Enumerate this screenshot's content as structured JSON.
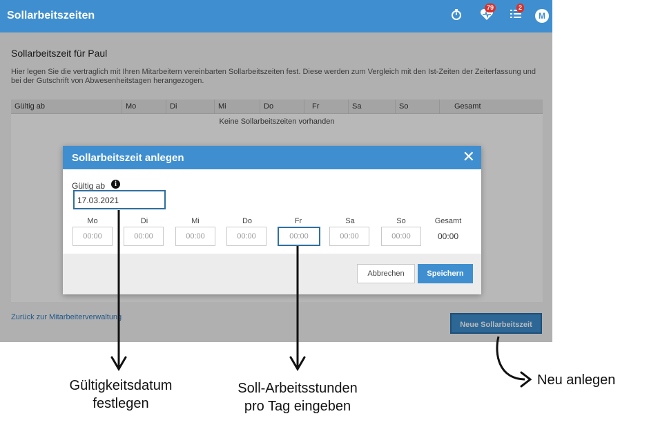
{
  "app": {
    "title": "Sollarbeitszeiten",
    "badge_health": "79",
    "badge_tasks": "2",
    "avatar_initial": "M"
  },
  "page": {
    "title": "Sollarbeitszeit für Paul",
    "description": "Hier legen Sie die vertraglich mit Ihren Mitarbeitern vereinbarten Sollarbeitszeiten fest. Diese werden zum Vergleich mit den Ist-Zeiten der Zeiterfassung und bei der Gutschrift von Abwesenheitstagen herangezogen.",
    "table_headers": [
      "Gültig ab",
      "Mo",
      "Di",
      "Mi",
      "Do",
      "Fr",
      "Sa",
      "So",
      "Gesamt"
    ],
    "empty_text": "Keine Sollarbeitszeiten vorhanden",
    "back_link": "Zurück zur Mitarbeiterverwaltung",
    "new_button": "Neue Sollarbeitszeit"
  },
  "modal": {
    "title": "Sollarbeitszeit anlegen",
    "date_label": "Gültig ab",
    "date_value": "17.03.2021",
    "days": [
      "Mo",
      "Di",
      "Mi",
      "Do",
      "Fr",
      "Sa",
      "So"
    ],
    "time_placeholder": "00:00",
    "total_label": "Gesamt",
    "total_value": "00:00",
    "cancel": "Abbrechen",
    "save": "Speichern"
  },
  "annotations": {
    "date_line1": "Gültigkeitsdatum",
    "date_line2": "festlegen",
    "hours_line1": "Soll-Arbeitsstunden",
    "hours_line2": "pro Tag eingeben",
    "new_text": "Neu anlegen"
  }
}
